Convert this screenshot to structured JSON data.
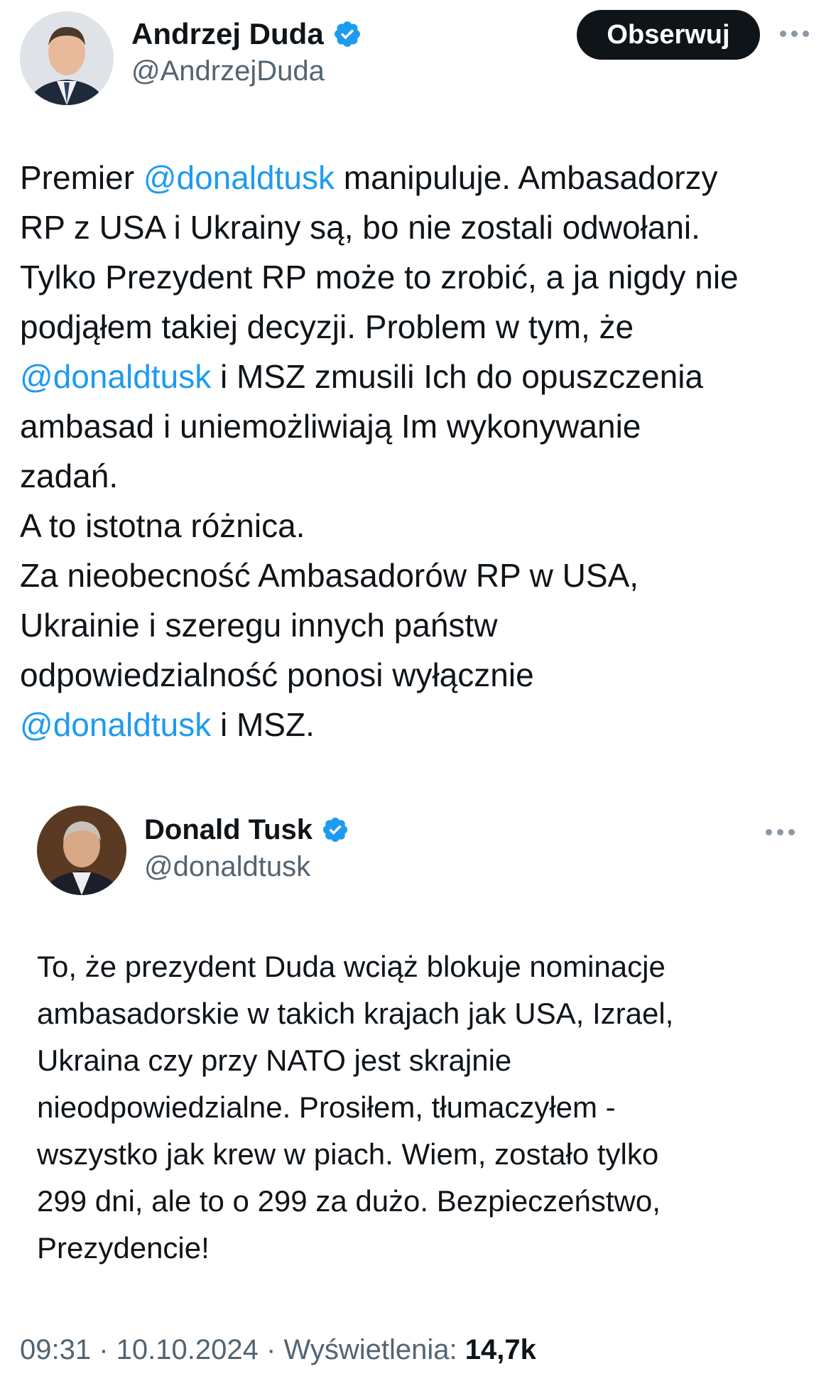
{
  "main_tweet": {
    "author_name": "Andrzej Duda",
    "author_handle": "@AndrzejDuda",
    "follow_label": "Obserwuj",
    "lines": [
      [
        {
          "t": "Premier "
        },
        {
          "t": "@donaldtusk",
          "m": true
        },
        {
          "t": " manipuluje. Ambasadorzy"
        }
      ],
      [
        {
          "t": "RP z USA i Ukrainy są, bo nie zostali odwołani."
        }
      ],
      [
        {
          "t": "Tylko Prezydent RP może to zrobić, a ja nigdy nie"
        }
      ],
      [
        {
          "t": "podjąłem takiej decyzji. Problem w tym, że"
        }
      ],
      [
        {
          "t": "@donaldtusk",
          "m": true
        },
        {
          "t": " i MSZ zmusili Ich do opuszczenia"
        }
      ],
      [
        {
          "t": "ambasad i uniemożliwiają Im wykonywanie"
        }
      ],
      [
        {
          "t": "zadań."
        }
      ],
      [
        {
          "t": "A to istotna różnica."
        }
      ],
      [
        {
          "t": "Za nieobecność Ambasadorów RP w USA,"
        }
      ],
      [
        {
          "t": "Ukrainie i szeregu innych państw"
        }
      ],
      [
        {
          "t": "odpowiedzialność ponosi wyłącznie"
        }
      ],
      [
        {
          "t": "@donaldtusk",
          "m": true
        },
        {
          "t": " i MSZ."
        }
      ]
    ]
  },
  "quoted_tweet": {
    "author_name": "Donald Tusk",
    "author_handle": "@donaldtusk",
    "lines": [
      "To, że prezydent Duda wciąż blokuje nominacje",
      "ambasadorskie w takich krajach jak USA, Izrael,",
      "Ukraina czy przy NATO jest skrajnie",
      "nieodpowiedzialne. Prosiłem, tłumaczyłem -",
      "wszystko jak krew w piach. Wiem, zostało tylko",
      "299 dni, ale to o 299 za dużo. Bezpieczeństwo,",
      "Prezydencie!"
    ]
  },
  "footer": {
    "time": "09:31",
    "date": "10.10.2024",
    "views_label": "Wyświetlenia:",
    "views_count": "14,7k"
  },
  "colors": {
    "mention": "#1d9bf0",
    "verified": "#1d9bf0",
    "text": "#0f1419",
    "muted": "#536471"
  }
}
